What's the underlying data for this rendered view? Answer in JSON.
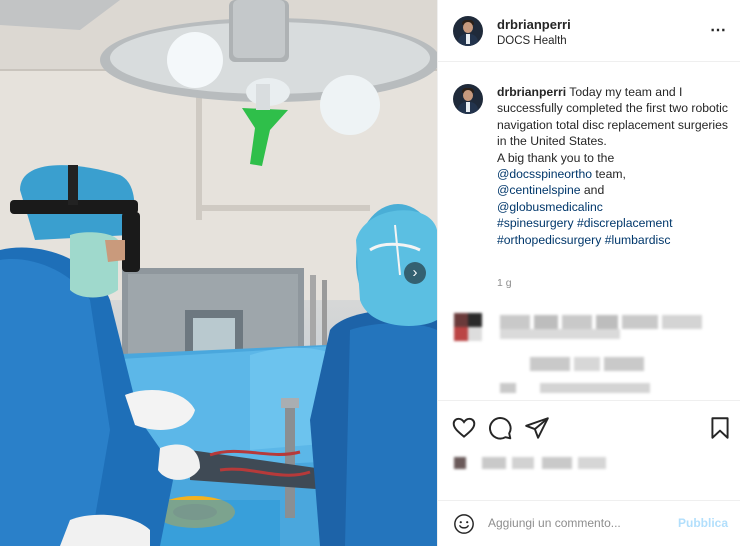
{
  "post": {
    "username": "drbrianperri",
    "location": "DOCS Health",
    "more_icon": "⋯"
  },
  "caption": {
    "username": "drbrianperri",
    "text": "Today my team and I successfully completed the first two robotic navigation total disc replacement surgeries in the United States.",
    "thanks_prefix": "A big thank you to the",
    "mention_1": "@docsspineortho",
    "mention_1_suffix": " team,",
    "mention_2": "@centinelspine",
    "mention_2_suffix": " and",
    "mention_3": "@globusmedicalinc",
    "hashtags_line_1": "#spinesurgery #discreplacement",
    "hashtags_line_2": "#orthopedicsurgery #lumbardisc",
    "time": "1 g"
  },
  "photo": {
    "next_icon": "›",
    "icon_name": "chevron-right-icon"
  },
  "actions": {
    "like_icon": "heart-icon",
    "comment_icon": "comment-icon",
    "share_icon": "send-icon",
    "save_icon": "bookmark-icon"
  },
  "comment_bar": {
    "emoji_icon": "emoji-icon",
    "placeholder": "Aggiungi un commento...",
    "publish_label": "Pubblica"
  },
  "colors": {
    "link": "#00376b",
    "muted": "#8e8e8e",
    "publish_disabled": "#b2dffc",
    "scrub_blue": "#2f74c4"
  }
}
